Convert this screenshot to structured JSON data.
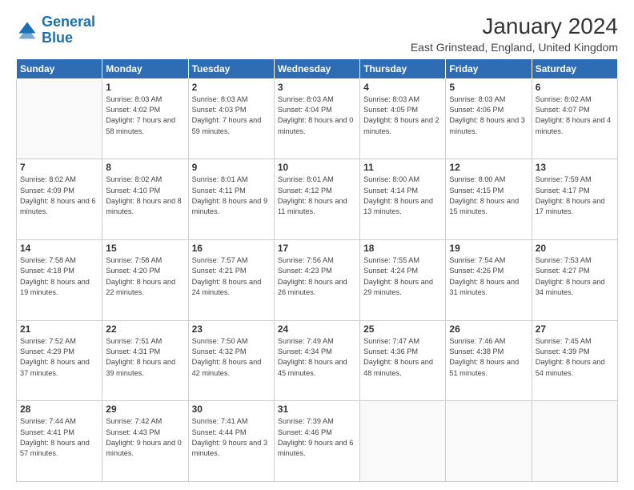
{
  "header": {
    "logo_general": "General",
    "logo_blue": "Blue",
    "title": "January 2024",
    "subtitle": "East Grinstead, England, United Kingdom"
  },
  "weekdays": [
    "Sunday",
    "Monday",
    "Tuesday",
    "Wednesday",
    "Thursday",
    "Friday",
    "Saturday"
  ],
  "weeks": [
    [
      {
        "day": "",
        "sunrise": "",
        "sunset": "",
        "daylight": "",
        "empty": true
      },
      {
        "day": "1",
        "sunrise": "Sunrise: 8:03 AM",
        "sunset": "Sunset: 4:02 PM",
        "daylight": "Daylight: 7 hours and 58 minutes."
      },
      {
        "day": "2",
        "sunrise": "Sunrise: 8:03 AM",
        "sunset": "Sunset: 4:03 PM",
        "daylight": "Daylight: 7 hours and 59 minutes."
      },
      {
        "day": "3",
        "sunrise": "Sunrise: 8:03 AM",
        "sunset": "Sunset: 4:04 PM",
        "daylight": "Daylight: 8 hours and 0 minutes."
      },
      {
        "day": "4",
        "sunrise": "Sunrise: 8:03 AM",
        "sunset": "Sunset: 4:05 PM",
        "daylight": "Daylight: 8 hours and 2 minutes."
      },
      {
        "day": "5",
        "sunrise": "Sunrise: 8:03 AM",
        "sunset": "Sunset: 4:06 PM",
        "daylight": "Daylight: 8 hours and 3 minutes."
      },
      {
        "day": "6",
        "sunrise": "Sunrise: 8:02 AM",
        "sunset": "Sunset: 4:07 PM",
        "daylight": "Daylight: 8 hours and 4 minutes."
      }
    ],
    [
      {
        "day": "7",
        "sunrise": "Sunrise: 8:02 AM",
        "sunset": "Sunset: 4:09 PM",
        "daylight": "Daylight: 8 hours and 6 minutes."
      },
      {
        "day": "8",
        "sunrise": "Sunrise: 8:02 AM",
        "sunset": "Sunset: 4:10 PM",
        "daylight": "Daylight: 8 hours and 8 minutes."
      },
      {
        "day": "9",
        "sunrise": "Sunrise: 8:01 AM",
        "sunset": "Sunset: 4:11 PM",
        "daylight": "Daylight: 8 hours and 9 minutes."
      },
      {
        "day": "10",
        "sunrise": "Sunrise: 8:01 AM",
        "sunset": "Sunset: 4:12 PM",
        "daylight": "Daylight: 8 hours and 11 minutes."
      },
      {
        "day": "11",
        "sunrise": "Sunrise: 8:00 AM",
        "sunset": "Sunset: 4:14 PM",
        "daylight": "Daylight: 8 hours and 13 minutes."
      },
      {
        "day": "12",
        "sunrise": "Sunrise: 8:00 AM",
        "sunset": "Sunset: 4:15 PM",
        "daylight": "Daylight: 8 hours and 15 minutes."
      },
      {
        "day": "13",
        "sunrise": "Sunrise: 7:59 AM",
        "sunset": "Sunset: 4:17 PM",
        "daylight": "Daylight: 8 hours and 17 minutes."
      }
    ],
    [
      {
        "day": "14",
        "sunrise": "Sunrise: 7:58 AM",
        "sunset": "Sunset: 4:18 PM",
        "daylight": "Daylight: 8 hours and 19 minutes."
      },
      {
        "day": "15",
        "sunrise": "Sunrise: 7:58 AM",
        "sunset": "Sunset: 4:20 PM",
        "daylight": "Daylight: 8 hours and 22 minutes."
      },
      {
        "day": "16",
        "sunrise": "Sunrise: 7:57 AM",
        "sunset": "Sunset: 4:21 PM",
        "daylight": "Daylight: 8 hours and 24 minutes."
      },
      {
        "day": "17",
        "sunrise": "Sunrise: 7:56 AM",
        "sunset": "Sunset: 4:23 PM",
        "daylight": "Daylight: 8 hours and 26 minutes."
      },
      {
        "day": "18",
        "sunrise": "Sunrise: 7:55 AM",
        "sunset": "Sunset: 4:24 PM",
        "daylight": "Daylight: 8 hours and 29 minutes."
      },
      {
        "day": "19",
        "sunrise": "Sunrise: 7:54 AM",
        "sunset": "Sunset: 4:26 PM",
        "daylight": "Daylight: 8 hours and 31 minutes."
      },
      {
        "day": "20",
        "sunrise": "Sunrise: 7:53 AM",
        "sunset": "Sunset: 4:27 PM",
        "daylight": "Daylight: 8 hours and 34 minutes."
      }
    ],
    [
      {
        "day": "21",
        "sunrise": "Sunrise: 7:52 AM",
        "sunset": "Sunset: 4:29 PM",
        "daylight": "Daylight: 8 hours and 37 minutes."
      },
      {
        "day": "22",
        "sunrise": "Sunrise: 7:51 AM",
        "sunset": "Sunset: 4:31 PM",
        "daylight": "Daylight: 8 hours and 39 minutes."
      },
      {
        "day": "23",
        "sunrise": "Sunrise: 7:50 AM",
        "sunset": "Sunset: 4:32 PM",
        "daylight": "Daylight: 8 hours and 42 minutes."
      },
      {
        "day": "24",
        "sunrise": "Sunrise: 7:49 AM",
        "sunset": "Sunset: 4:34 PM",
        "daylight": "Daylight: 8 hours and 45 minutes."
      },
      {
        "day": "25",
        "sunrise": "Sunrise: 7:47 AM",
        "sunset": "Sunset: 4:36 PM",
        "daylight": "Daylight: 8 hours and 48 minutes."
      },
      {
        "day": "26",
        "sunrise": "Sunrise: 7:46 AM",
        "sunset": "Sunset: 4:38 PM",
        "daylight": "Daylight: 8 hours and 51 minutes."
      },
      {
        "day": "27",
        "sunrise": "Sunrise: 7:45 AM",
        "sunset": "Sunset: 4:39 PM",
        "daylight": "Daylight: 8 hours and 54 minutes."
      }
    ],
    [
      {
        "day": "28",
        "sunrise": "Sunrise: 7:44 AM",
        "sunset": "Sunset: 4:41 PM",
        "daylight": "Daylight: 8 hours and 57 minutes."
      },
      {
        "day": "29",
        "sunrise": "Sunrise: 7:42 AM",
        "sunset": "Sunset: 4:43 PM",
        "daylight": "Daylight: 9 hours and 0 minutes."
      },
      {
        "day": "30",
        "sunrise": "Sunrise: 7:41 AM",
        "sunset": "Sunset: 4:44 PM",
        "daylight": "Daylight: 9 hours and 3 minutes."
      },
      {
        "day": "31",
        "sunrise": "Sunrise: 7:39 AM",
        "sunset": "Sunset: 4:46 PM",
        "daylight": "Daylight: 9 hours and 6 minutes."
      },
      {
        "day": "",
        "sunrise": "",
        "sunset": "",
        "daylight": "",
        "empty": true
      },
      {
        "day": "",
        "sunrise": "",
        "sunset": "",
        "daylight": "",
        "empty": true
      },
      {
        "day": "",
        "sunrise": "",
        "sunset": "",
        "daylight": "",
        "empty": true
      }
    ]
  ]
}
